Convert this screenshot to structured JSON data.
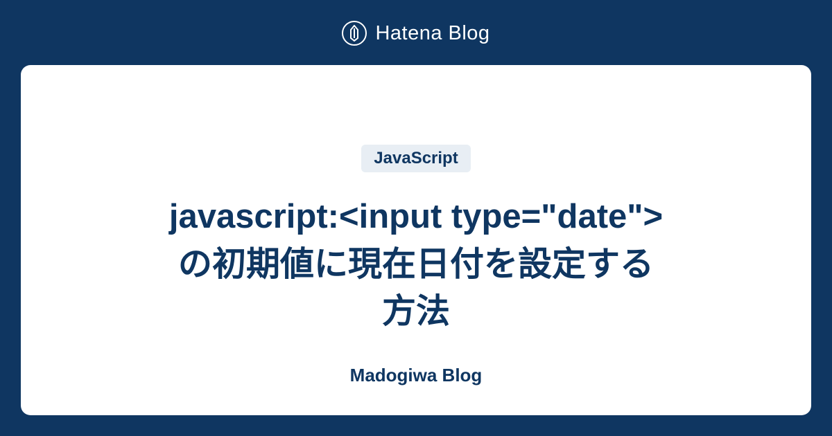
{
  "header": {
    "platform_name": "Hatena Blog"
  },
  "card": {
    "tag": "JavaScript",
    "title": "javascript:<input type=\"date\">の初期値に現在日付を設定する方法",
    "blog_name": "Madogiwa Blog"
  }
}
